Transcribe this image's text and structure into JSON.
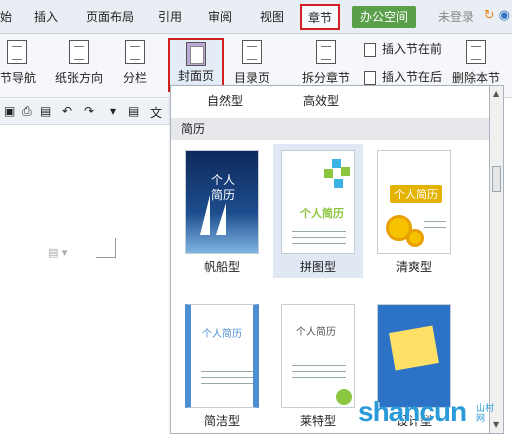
{
  "menubar": {
    "items": [
      "始",
      "插入",
      "页面布局",
      "引用",
      "审阅",
      "视图",
      "章节",
      "办公空间",
      "未登录"
    ],
    "active": "章节"
  },
  "ribbon": {
    "nav_label": "节导航",
    "orientation_label": "纸张方向",
    "columns_label": "分栏",
    "cover_label": "封面页",
    "toc_label": "目录页",
    "split_label": "拆分章节",
    "insert_before_label": "插入节在前",
    "insert_after_label": "插入节在后",
    "delete_section_label": "删除本节"
  },
  "toolbar2": {
    "doc_tab": "文"
  },
  "gallery": {
    "top_row": [
      "自然型",
      "高效型"
    ],
    "section": "简历",
    "items": [
      {
        "caption": "帆船型",
        "title": "个人简历"
      },
      {
        "caption": "拼图型",
        "title": "个人简历"
      },
      {
        "caption": "清爽型",
        "title": "个人简历"
      },
      {
        "caption": "简洁型",
        "title": "个人简历"
      },
      {
        "caption": "莱特型",
        "title": "个人简历"
      },
      {
        "caption": "设计型",
        "title": ""
      }
    ]
  },
  "watermark": {
    "text": "shancun",
    "sub": "山村网"
  }
}
